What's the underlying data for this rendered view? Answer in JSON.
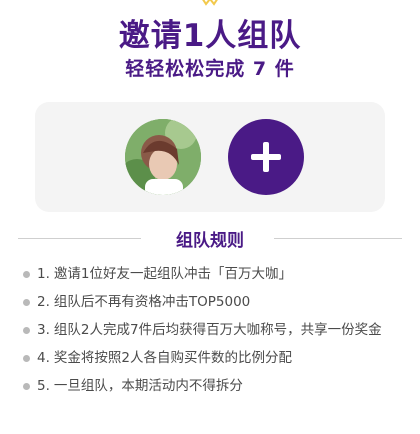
{
  "header": {
    "title": "邀请1人组队",
    "subtitle": "轻轻松松完成 7 件"
  },
  "team": {
    "add_icon": "plus-icon"
  },
  "rules": {
    "title": "组队规则",
    "items": [
      {
        "num": "1.",
        "text": "邀请1位好友一起组队冲击「百万大咖」"
      },
      {
        "num": "2.",
        "text": "组队后不再有资格冲击TOP5000"
      },
      {
        "num": "3.",
        "text": "组队2人完成7件后均获得百万大咖称号，共享一份奖金"
      },
      {
        "num": "4.",
        "text": "奖金将按照2人各自购买件数的比例分配"
      },
      {
        "num": "5.",
        "text": "一旦组队，本期活动内不得拆分"
      }
    ]
  },
  "colors": {
    "brand": "#4a1a86",
    "card_bg": "#f4f4f4",
    "bullet": "#b9b9b9"
  }
}
